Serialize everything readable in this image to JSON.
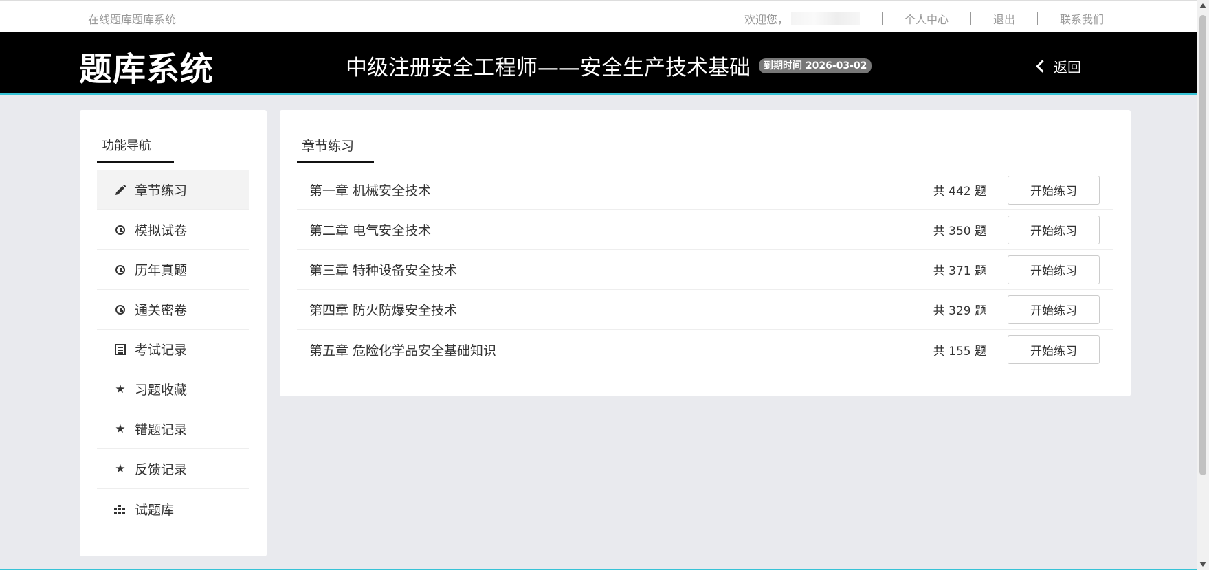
{
  "topbar": {
    "site_name": "在线题库题库系统",
    "welcome": "欢迎您，",
    "links": [
      "个人中心",
      "退出",
      "联系我们"
    ]
  },
  "header": {
    "logo": "题库系统",
    "subject": "中级注册安全工程师——安全生产技术基础",
    "expire_label": "到期时间 2026-03-02",
    "back_label": "返回"
  },
  "sidebar": {
    "title": "功能导航",
    "items": [
      {
        "label": "章节练习",
        "icon": "pencil-icon",
        "active": true
      },
      {
        "label": "模拟试卷",
        "icon": "clock-icon"
      },
      {
        "label": "历年真题",
        "icon": "clock-icon"
      },
      {
        "label": "通关密卷",
        "icon": "clock-icon"
      },
      {
        "label": "考试记录",
        "icon": "list-icon"
      },
      {
        "label": "习题收藏",
        "icon": "star-icon"
      },
      {
        "label": "错题记录",
        "icon": "star-icon"
      },
      {
        "label": "反馈记录",
        "icon": "star-icon"
      },
      {
        "label": "试题库",
        "icon": "bars-icon"
      }
    ]
  },
  "main": {
    "tab": "章节练习",
    "chapters": [
      {
        "title": "第一章 机械安全技术",
        "count": "共 442 题",
        "button": "开始练习"
      },
      {
        "title": "第二章 电气安全技术",
        "count": "共 350 题",
        "button": "开始练习"
      },
      {
        "title": "第三章 特种设备安全技术",
        "count": "共 371 题",
        "button": "开始练习"
      },
      {
        "title": "第四章 防火防爆安全技术",
        "count": "共 329 题",
        "button": "开始练习"
      },
      {
        "title": "第五章 危险化学品安全基础知识",
        "count": "共 155 题",
        "button": "开始练习"
      }
    ]
  },
  "colors": {
    "header_bg": "#000000",
    "accent": "#37c3d6",
    "page_bg": "#e9eaee"
  }
}
